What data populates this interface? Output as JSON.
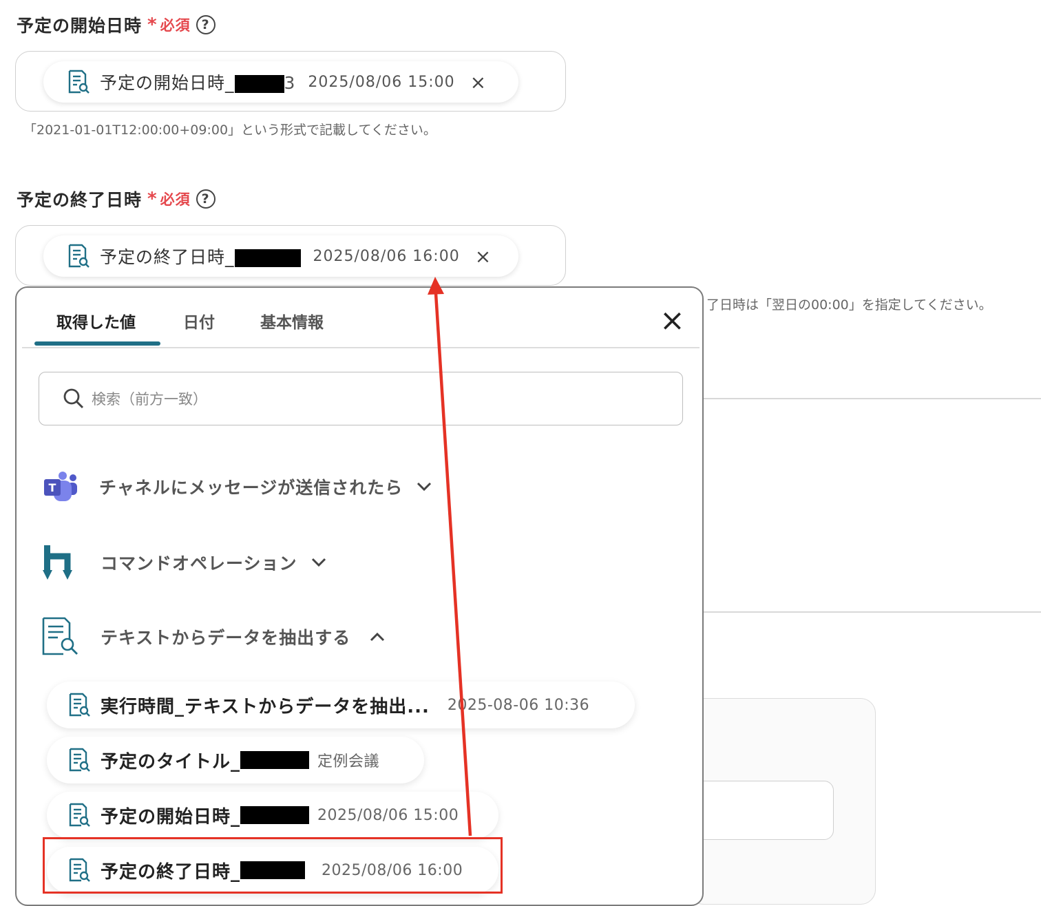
{
  "start_field": {
    "label": "予定の開始日時",
    "required_mark": "*",
    "required_text": "必須",
    "help_icon": "?",
    "chip_name": "予定の開始日時_",
    "chip_suffix": "3",
    "chip_value": "2025/08/06 15:00",
    "remove_icon": "×",
    "note": "「2021-01-01T12:00:00+09:00」という形式で記載してください。"
  },
  "end_field": {
    "label": "予定の終了日時",
    "required_mark": "*",
    "required_text": "必須",
    "help_icon": "?",
    "chip_name": "予定の終了日時_",
    "chip_value": "2025/08/06 16:00",
    "remove_icon": "×",
    "note_partial": "了日時は「翌日の00:00」を指定してください。"
  },
  "picker": {
    "tabs": [
      "取得した値",
      "日付",
      "基本情報"
    ],
    "active_tab": 0,
    "close_icon": "×",
    "search_placeholder": "検索（前方一致）",
    "groups": [
      {
        "label": "チャネルにメッセージが送信されたら",
        "icon": "teams-icon",
        "expanded": false
      },
      {
        "label": "コマンドオペレーション",
        "icon": "command-operation-icon",
        "expanded": false
      },
      {
        "label": "テキストからデータを抽出する",
        "icon": "extract-text-icon",
        "expanded": true
      }
    ],
    "items": [
      {
        "name": "実行時間_テキストからデータを抽出...",
        "value": "2025-08-06 10:36"
      },
      {
        "name": "予定のタイトル_",
        "value": "定例会議"
      },
      {
        "name": "予定の開始日時_",
        "value": "2025/08/06 15:00"
      },
      {
        "name": "予定の終了日時_",
        "value": "2025/08/06 16:00"
      }
    ]
  },
  "colors": {
    "required": "#e5484d",
    "tab_underline": "#1f6f86",
    "highlight": "#e53225",
    "teams_purple": "#5b5fc7",
    "command_teal": "#1f6f86"
  }
}
